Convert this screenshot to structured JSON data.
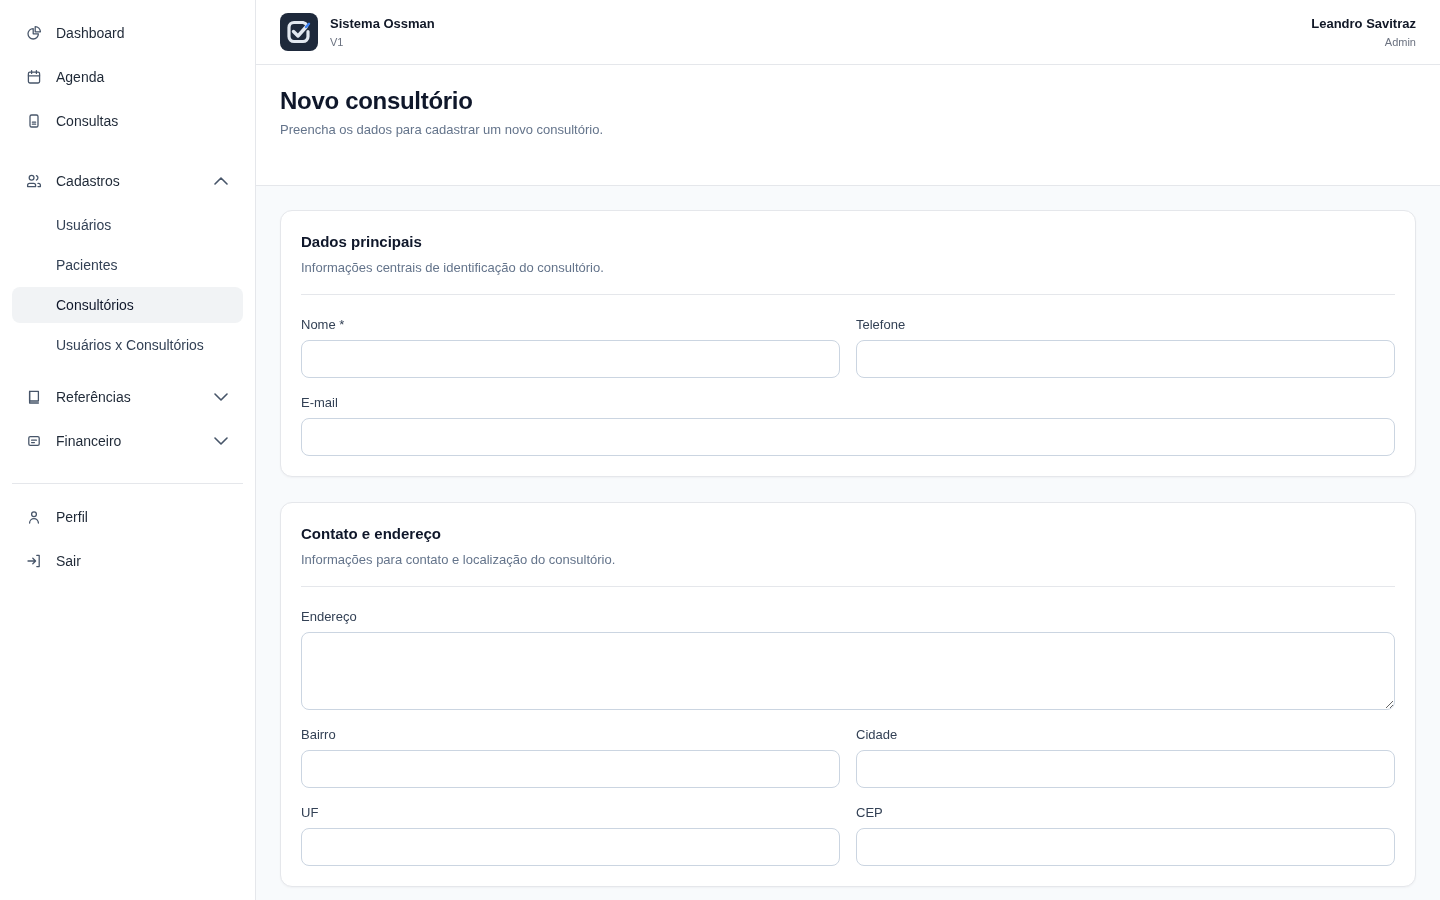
{
  "sidebar": {
    "menu": [
      {
        "label": "Dashboard",
        "selected": false
      },
      {
        "label": "Agenda",
        "selected": false
      },
      {
        "label": "Consultas",
        "selected": false
      }
    ],
    "groups": [
      {
        "label": "Cadastros",
        "expanded": true,
        "children": [
          {
            "label": "Usuários",
            "selected": false
          },
          {
            "label": "Pacientes",
            "selected": false
          },
          {
            "label": "Consultórios",
            "selected": true
          },
          {
            "label": "Usuários x Consultórios",
            "selected": false
          }
        ]
      },
      {
        "label": "Referências",
        "expanded": false
      },
      {
        "label": "Financeiro",
        "expanded": false
      }
    ],
    "account": [
      {
        "label": "Perfil",
        "selected": false
      },
      {
        "label": "Sair",
        "selected": false
      }
    ]
  },
  "header": {
    "app_name": "Sistema Ossman",
    "version": "V1",
    "user_name": "Leandro Savitraz",
    "user_role": "Admin"
  },
  "page": {
    "title": "Novo consultório",
    "subtitle": "Preencha os dados para cadastrar um novo consultório."
  },
  "sections": [
    {
      "title": "Dados principais",
      "description": "Informações centrais de identificação do consultório.",
      "rows": [
        [
          {
            "label": "Nome *",
            "kind": "input"
          },
          {
            "label": "Telefone",
            "kind": "input"
          }
        ],
        [
          {
            "label": "E-mail",
            "kind": "input"
          }
        ]
      ]
    },
    {
      "title": "Contato e endereço",
      "description": "Informações para contato e localização do consultório.",
      "rows": [
        [
          {
            "label": "Endereço",
            "kind": "textarea"
          }
        ],
        [
          {
            "label": "Bairro",
            "kind": "input"
          },
          {
            "label": "Cidade",
            "kind": "input"
          }
        ],
        [
          {
            "label": "UF",
            "kind": "input"
          },
          {
            "label": "CEP",
            "kind": "input"
          }
        ]
      ]
    }
  ]
}
